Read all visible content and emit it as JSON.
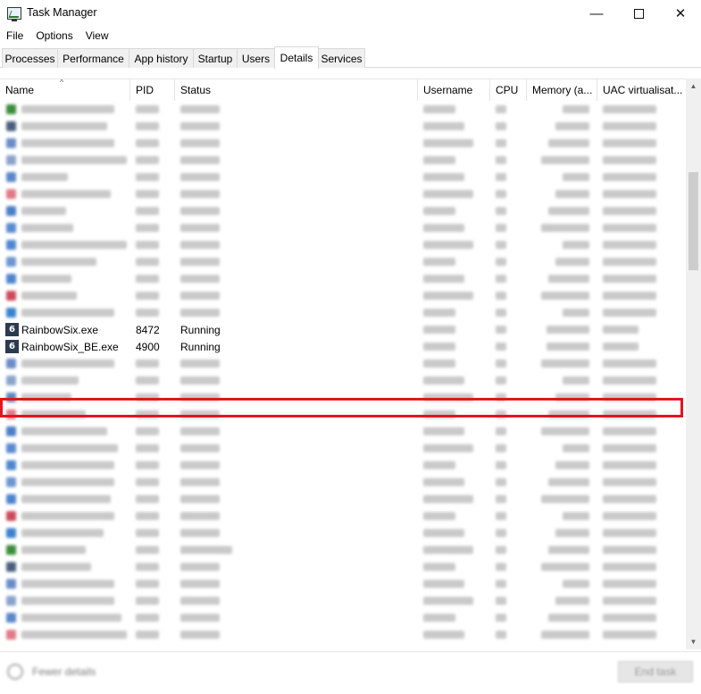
{
  "window": {
    "title": "Task Manager",
    "minimize": "—",
    "close": "✕"
  },
  "menu": [
    "File",
    "Options",
    "View"
  ],
  "tabs": [
    "Processes",
    "Performance",
    "App history",
    "Startup",
    "Users",
    "Details",
    "Services"
  ],
  "active_tab": "Details",
  "columns": [
    "Name",
    "PID",
    "Status",
    "Username",
    "CPU",
    "Memory (a...",
    "UAC virtualisat..."
  ],
  "sort_indicator": "^",
  "highlight_color": "#e3161f",
  "visible_rows": [
    {
      "name": "RainbowSix.exe",
      "pid": "8472",
      "status": "Running",
      "icon": "rainbow-six-icon",
      "highlighted": true
    },
    {
      "name": "RainbowSix_BE.exe",
      "pid": "4900",
      "status": "Running",
      "icon": "rainbow-six-icon",
      "highlighted": false
    }
  ],
  "footer": {
    "fewer_details": "Fewer details",
    "end_task": "End task"
  }
}
